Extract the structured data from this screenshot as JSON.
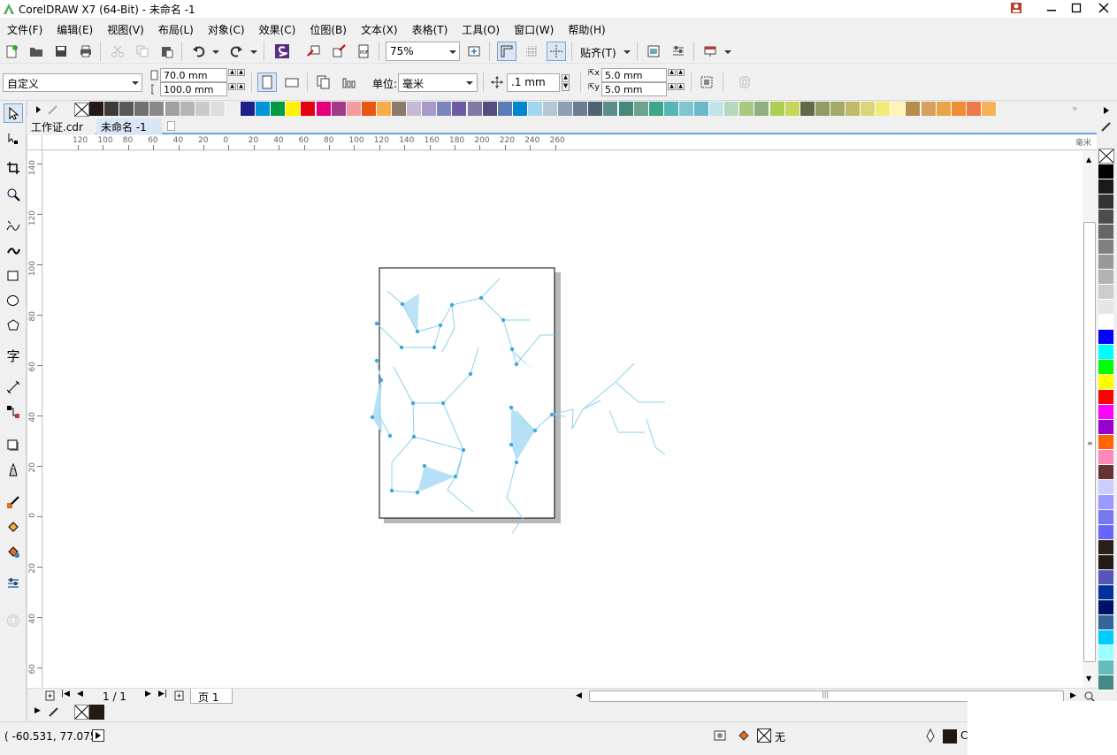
{
  "window": {
    "title": "CorelDRAW X7 (64-Bit) - 未命名 -1"
  },
  "menu": [
    "文件(F)",
    "编辑(E)",
    "视图(V)",
    "布局(L)",
    "对象(C)",
    "效果(C)",
    "位图(B)",
    "文本(X)",
    "表格(T)",
    "工具(O)",
    "窗口(W)",
    "帮助(H)"
  ],
  "toolbar": {
    "zoom": "75%",
    "snap_label": "贴齐(T)"
  },
  "property_bar": {
    "page_preset": "自定义",
    "width": "70.0 mm",
    "height": "100.0 mm",
    "units_label": "单位:",
    "units": "毫米",
    "nudge": ".1 mm",
    "dup_x": "5.0 mm",
    "dup_y": "5.0 mm"
  },
  "tabs": [
    {
      "label": "工作证.cdr",
      "active": false
    },
    {
      "label": "未命名 -1",
      "active": true
    }
  ],
  "rulers": {
    "h_labels": [
      "120",
      "100",
      "80",
      "60",
      "40",
      "20",
      "0",
      "20",
      "40",
      "60",
      "80",
      "100",
      "120",
      "140",
      "160",
      "180",
      "200",
      "220",
      "240",
      "260"
    ],
    "h_unit": "毫米",
    "v_labels": [
      "140",
      "120",
      "100",
      "80",
      "60",
      "40",
      "20",
      "0",
      "20",
      "40",
      "60"
    ]
  },
  "page_nav": {
    "counter": "1 / 1",
    "page_tab": "页 1"
  },
  "status": {
    "coords": "( -60.531, 77.075 )",
    "fill_label": "无",
    "outline_label": "C"
  },
  "palette_top": [
    "#231815",
    "#3e3a39",
    "#595757",
    "#727171",
    "#898989",
    "#9fa0a0",
    "#b5b5b6",
    "#c9caca",
    "#dcdddd",
    "#efefef",
    "#1d2088",
    "#0095d9",
    "#009944",
    "#fff100",
    "#e60012",
    "#e4007f",
    "#a3398a",
    "#f29c9f",
    "#e95513",
    "#f6ad49",
    "#8c7a6b",
    "#c7b9d6",
    "#a59aca",
    "#7a84bd",
    "#6c5ba3",
    "#8079a6",
    "#544e7c",
    "#5b7cb5",
    "#0086d1",
    "#a2d7f0",
    "#b3c7d5",
    "#8da0b6",
    "#6b7d8e",
    "#4e6372",
    "#5c8d89",
    "#43887a",
    "#6ba38f",
    "#3fa58c",
    "#57b6b5",
    "#7fc6d2",
    "#69b9cb",
    "#c1e4e9",
    "#b8d8be",
    "#a8c97f",
    "#8fae80",
    "#aacf53",
    "#c7d65a",
    "#5e6b46",
    "#939a66",
    "#a3a96c",
    "#c1b868",
    "#d9d57c",
    "#f3ea7c",
    "#fef4b8",
    "#b68d4c",
    "#d7a05c",
    "#e6a548",
    "#f08c35",
    "#ee7948",
    "#f6b355"
  ],
  "palette_side": [
    "#000000",
    "#1a1a1a",
    "#333333",
    "#4d4d4d",
    "#666666",
    "#808080",
    "#999999",
    "#b3b3b3",
    "#cccccc",
    "#e6e6e6",
    "#ffffff",
    "#0000ff",
    "#00ffff",
    "#00ff00",
    "#ffff00",
    "#ff0000",
    "#ff00ff",
    "#9900cc",
    "#ff6600",
    "#ff88bb",
    "#663333",
    "#ccccff",
    "#9999ff",
    "#7777ee",
    "#6666ff",
    "#2a1f1a",
    "#221a15",
    "#5555bb",
    "#003399",
    "#001166",
    "#336699",
    "#00ccff",
    "#99ffff",
    "#66bbbb",
    "#448888"
  ]
}
